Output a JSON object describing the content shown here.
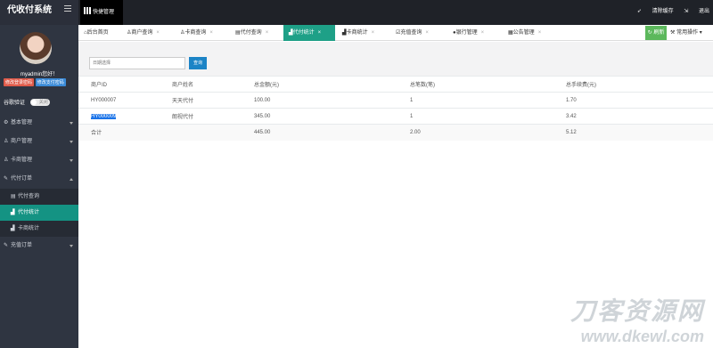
{
  "app": {
    "title": "代收付系统",
    "quick_menu": "快捷管理"
  },
  "topbar": {
    "clear_cache": "清除缓存",
    "logout": "退出"
  },
  "user": {
    "name": "myadmin您好！",
    "badge_login_pwd": "修改登录密码",
    "badge_pay_pwd": "修改支付密码",
    "verify_label": "谷歌验证",
    "verify_state": "关闭"
  },
  "sidebar": {
    "items": [
      {
        "label": "基本管理",
        "icon": "gear-icon"
      },
      {
        "label": "商户管理",
        "icon": "user-icon"
      },
      {
        "label": "卡商管理",
        "icon": "user-icon"
      },
      {
        "label": "代付订单",
        "icon": "edit-icon",
        "expanded": true,
        "children": [
          {
            "label": "代付查询",
            "icon": "doc-icon"
          },
          {
            "label": "代付统计",
            "icon": "bar-chart-icon",
            "active": true
          },
          {
            "label": "卡商统计",
            "icon": "bar-chart-icon"
          }
        ]
      },
      {
        "label": "充值订单",
        "icon": "edit-icon"
      }
    ]
  },
  "tabs": [
    {
      "label": "后台首页",
      "icon": "home-icon"
    },
    {
      "label": "商户查询",
      "icon": "user-icon"
    },
    {
      "label": "卡商查询",
      "icon": "users-icon"
    },
    {
      "label": "代付查询",
      "icon": "doc-icon"
    },
    {
      "label": "代付统计",
      "icon": "bar-chart-icon",
      "active": true
    },
    {
      "label": "卡商统计",
      "icon": "bar-chart-icon"
    },
    {
      "label": "充值查询",
      "icon": "check-icon"
    },
    {
      "label": "银行管理",
      "icon": "bank-icon"
    },
    {
      "label": "公告管理",
      "icon": "calendar-icon"
    }
  ],
  "refresh": "刷新",
  "common_ops": "常用操作",
  "search": {
    "placeholder": "日期选择",
    "button": "查询"
  },
  "table": {
    "headers": [
      "商户ID",
      "商户姓名",
      "总金额(元)",
      "总笔数(笔)",
      "总手续费(元)"
    ],
    "rows": [
      [
        "HY000007",
        "天天代付",
        "100.00",
        "1",
        "1.70"
      ],
      [
        "HY000009",
        "朗视代付",
        "345.00",
        "1",
        "3.42"
      ]
    ],
    "total": [
      "合计",
      "",
      "445.00",
      "2.00",
      "5.12"
    ]
  },
  "watermark": {
    "cn": "刀客资源网",
    "url": "www.dkewl.com"
  },
  "colors": {
    "accent": "#1ea087",
    "sidebar": "#2f3541",
    "topbar": "#1f2228",
    "primary": "#1c84c6"
  }
}
